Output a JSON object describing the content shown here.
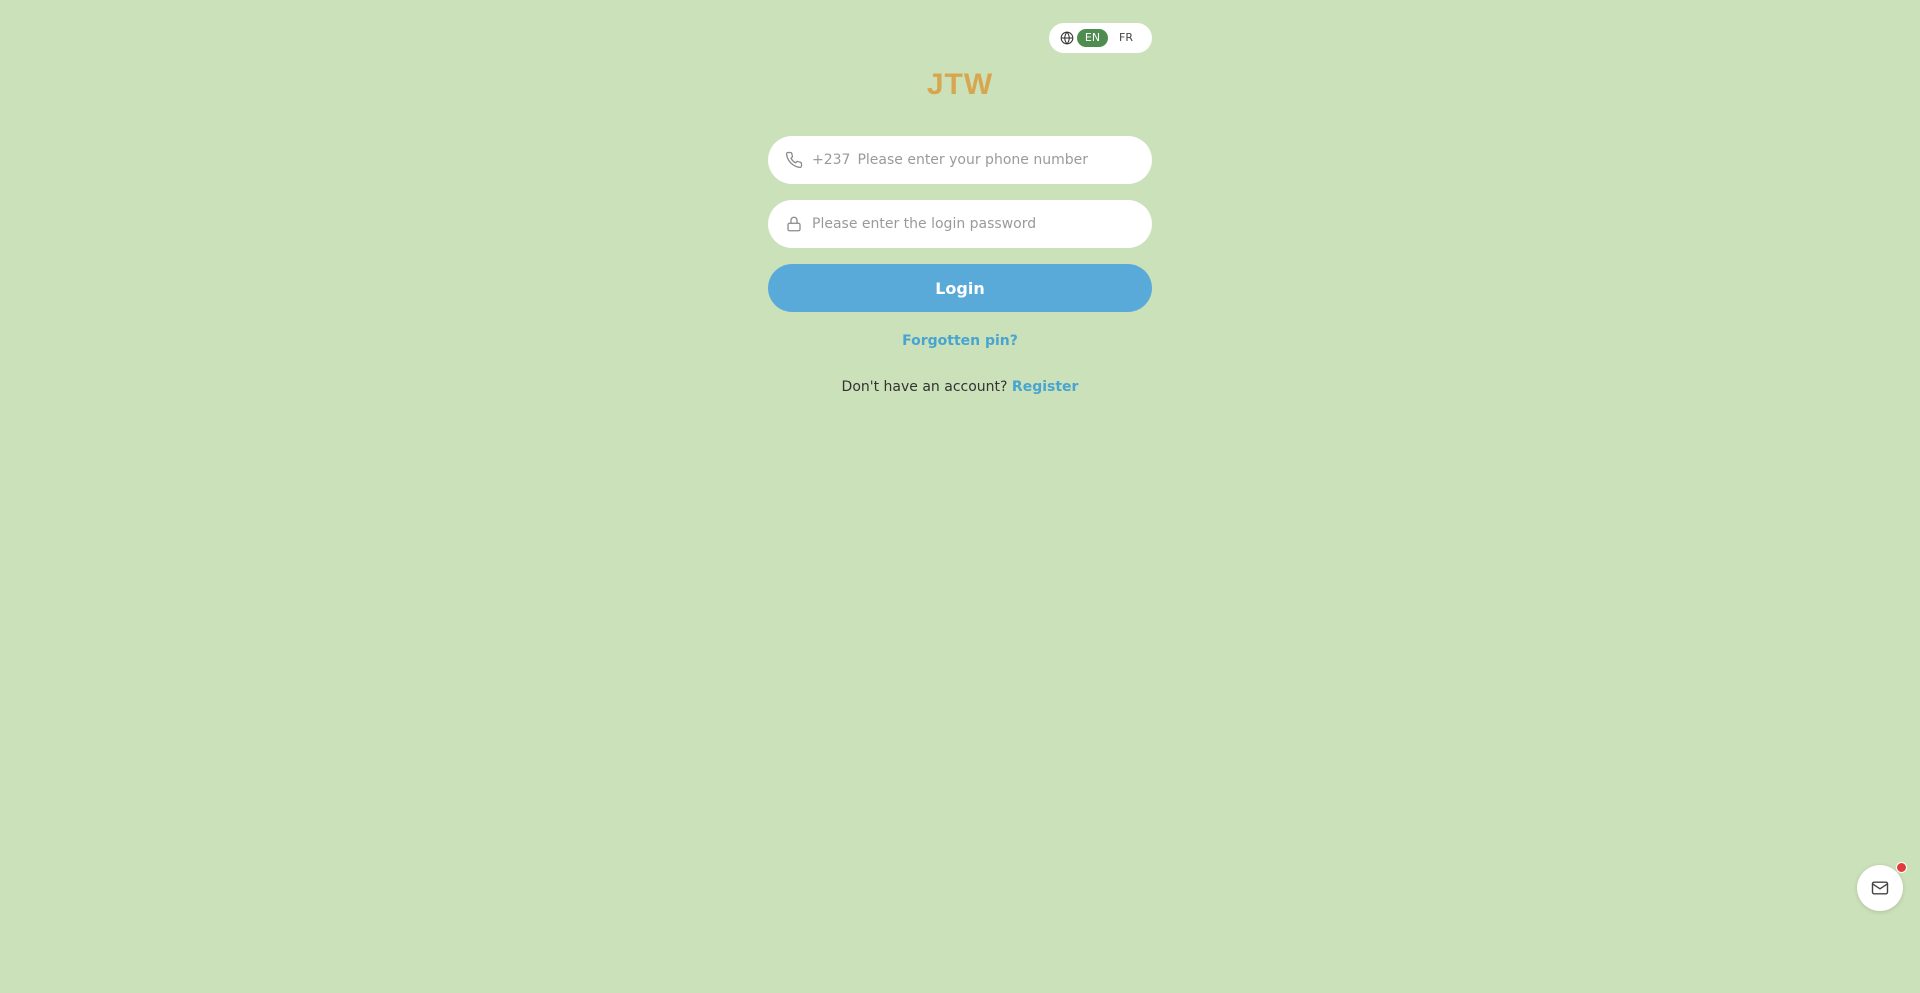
{
  "language_switch": {
    "options": [
      {
        "code": "EN",
        "active": true
      },
      {
        "code": "FR",
        "active": false
      }
    ],
    "icon": "globe-icon",
    "active_color": "#4f8c4f"
  },
  "brand": {
    "name": "JTW",
    "color": "#d9a650"
  },
  "phone_field": {
    "icon": "phone-icon",
    "prefix": "+237",
    "placeholder": "Please enter your phone number",
    "value": ""
  },
  "password_field": {
    "icon": "lock-icon",
    "placeholder": "Please enter the login password",
    "value": ""
  },
  "login_button": {
    "label": "Login",
    "color": "#5aaad9"
  },
  "forgot_link": {
    "label": "Forgotten pin?"
  },
  "register": {
    "prompt": "Don't have an account?",
    "link_label": "Register"
  },
  "messages_button": {
    "icon": "mail-icon",
    "has_notification": true,
    "badge_color": "#e23b3b"
  },
  "theme": {
    "background": "#cbe1ba",
    "link_color": "#48a4d0"
  }
}
